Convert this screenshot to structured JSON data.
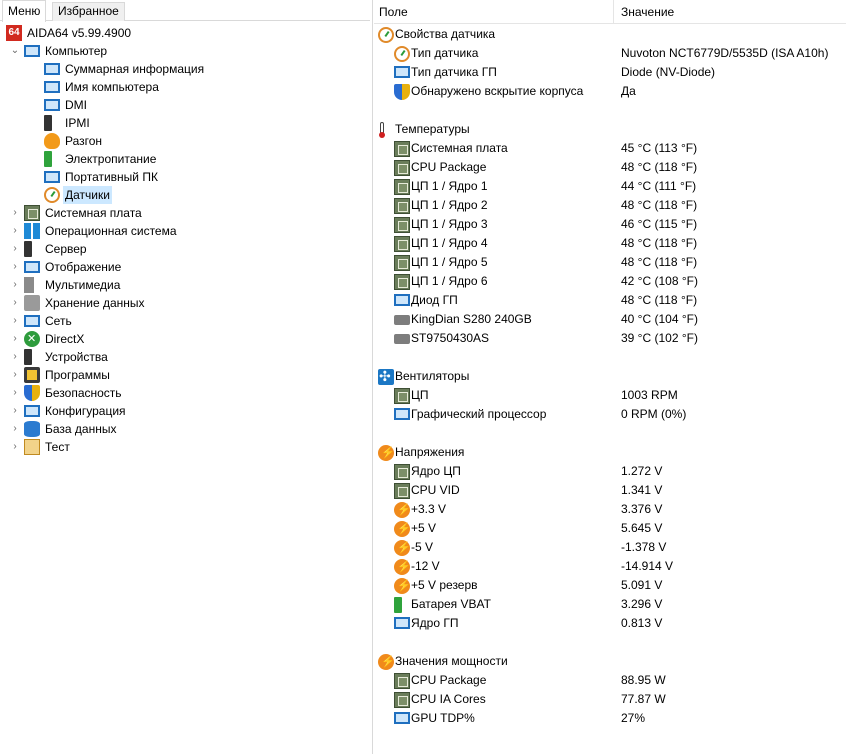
{
  "tabs": [
    "Меню",
    "Избранное"
  ],
  "tree": {
    "root": "AIDA64 v5.99.4900",
    "root_icon": "64",
    "computer": "Компьютер",
    "computer_children": [
      {
        "label": "Суммарная информация",
        "icon": "monitor-icon"
      },
      {
        "label": "Имя компьютера",
        "icon": "monitor-icon"
      },
      {
        "label": "DMI",
        "icon": "monitor-icon"
      },
      {
        "label": "IPMI",
        "icon": "server-icon"
      },
      {
        "label": "Разгон",
        "icon": "fire-icon"
      },
      {
        "label": "Электропитание",
        "icon": "battery-icon"
      },
      {
        "label": "Портативный ПК",
        "icon": "laptop-icon"
      },
      {
        "label": "Датчики",
        "icon": "gauge-icon"
      }
    ],
    "top_items": [
      {
        "label": "Системная плата",
        "icon": "motherboard-icon"
      },
      {
        "label": "Операционная система",
        "icon": "windows-icon"
      },
      {
        "label": "Сервер",
        "icon": "server-icon"
      },
      {
        "label": "Отображение",
        "icon": "monitor-icon"
      },
      {
        "label": "Мультимедиа",
        "icon": "speaker-icon"
      },
      {
        "label": "Хранение данных",
        "icon": "storage-icon"
      },
      {
        "label": "Сеть",
        "icon": "network-icon"
      },
      {
        "label": "DirectX",
        "icon": "xbox-icon"
      },
      {
        "label": "Устройства",
        "icon": "device-icon"
      },
      {
        "label": "Программы",
        "icon": "programs-icon"
      },
      {
        "label": "Безопасность",
        "icon": "shield-icon"
      },
      {
        "label": "Конфигурация",
        "icon": "config-icon"
      },
      {
        "label": "База данных",
        "icon": "database-icon"
      },
      {
        "label": "Тест",
        "icon": "test-icon"
      }
    ]
  },
  "columns": {
    "field": "Поле",
    "value": "Значение"
  },
  "sections": [
    {
      "title": "Свойства датчика",
      "icon": "gauge-icon",
      "rows": [
        {
          "f": "Тип датчика",
          "v": "Nuvoton NCT6779D/5535D  (ISA A10h)",
          "icon": "gauge-icon"
        },
        {
          "f": "Тип датчика ГП",
          "v": "Diode  (NV-Diode)",
          "icon": "monitor-icon"
        },
        {
          "f": "Обнаружено вскрытие корпуса",
          "v": "Да",
          "icon": "shield-icon"
        }
      ]
    },
    {
      "title": "Температуры",
      "icon": "thermometer-icon",
      "rows": [
        {
          "f": "Системная плата",
          "v": "45 °C  (113 °F)",
          "icon": "motherboard-icon"
        },
        {
          "f": "CPU Package",
          "v": "48 °C  (118 °F)",
          "icon": "chip-icon"
        },
        {
          "f": "ЦП 1 / Ядро 1",
          "v": "44 °C  (111 °F)",
          "icon": "chip-icon"
        },
        {
          "f": "ЦП 1 / Ядро 2",
          "v": "48 °C  (118 °F)",
          "icon": "chip-icon"
        },
        {
          "f": "ЦП 1 / Ядро 3",
          "v": "46 °C  (115 °F)",
          "icon": "chip-icon"
        },
        {
          "f": "ЦП 1 / Ядро 4",
          "v": "48 °C  (118 °F)",
          "icon": "chip-icon"
        },
        {
          "f": "ЦП 1 / Ядро 5",
          "v": "48 °C  (118 °F)",
          "icon": "chip-icon"
        },
        {
          "f": "ЦП 1 / Ядро 6",
          "v": "42 °C  (108 °F)",
          "icon": "chip-icon"
        },
        {
          "f": "Диод ГП",
          "v": "48 °C  (118 °F)",
          "icon": "monitor-icon"
        },
        {
          "f": "KingDian S280 240GB",
          "v": "40 °C  (104 °F)",
          "icon": "hdd-icon"
        },
        {
          "f": "ST9750430AS",
          "v": "39 °C  (102 °F)",
          "icon": "hdd-icon"
        }
      ]
    },
    {
      "title": "Вентиляторы",
      "icon": "fan-icon",
      "rows": [
        {
          "f": "ЦП",
          "v": "1003 RPM",
          "icon": "chip-icon"
        },
        {
          "f": "Графический процессор",
          "v": "0 RPM  (0%)",
          "icon": "monitor-icon"
        }
      ]
    },
    {
      "title": "Напряжения",
      "icon": "voltage-icon",
      "rows": [
        {
          "f": "Ядро ЦП",
          "v": "1.272 V",
          "icon": "chip-icon"
        },
        {
          "f": "CPU VID",
          "v": "1.341 V",
          "icon": "chip-icon"
        },
        {
          "f": "+3.3 V",
          "v": "3.376 V",
          "icon": "voltage-icon"
        },
        {
          "f": "+5 V",
          "v": "5.645 V",
          "icon": "voltage-icon"
        },
        {
          "f": "-5 V",
          "v": "-1.378 V",
          "icon": "voltage-icon"
        },
        {
          "f": "-12 V",
          "v": "-14.914 V",
          "icon": "voltage-icon"
        },
        {
          "f": "+5 V резерв",
          "v": "5.091 V",
          "icon": "voltage-icon"
        },
        {
          "f": "Батарея VBAT",
          "v": "3.296 V",
          "icon": "battery-icon"
        },
        {
          "f": "Ядро ГП",
          "v": "0.813 V",
          "icon": "monitor-icon"
        }
      ]
    },
    {
      "title": "Значения мощности",
      "icon": "voltage-icon",
      "rows": [
        {
          "f": "CPU Package",
          "v": "88.95 W",
          "icon": "chip-icon"
        },
        {
          "f": "CPU IA Cores",
          "v": "77.87 W",
          "icon": "chip-icon"
        },
        {
          "f": "GPU TDP%",
          "v": "27%",
          "icon": "monitor-icon"
        }
      ]
    }
  ]
}
